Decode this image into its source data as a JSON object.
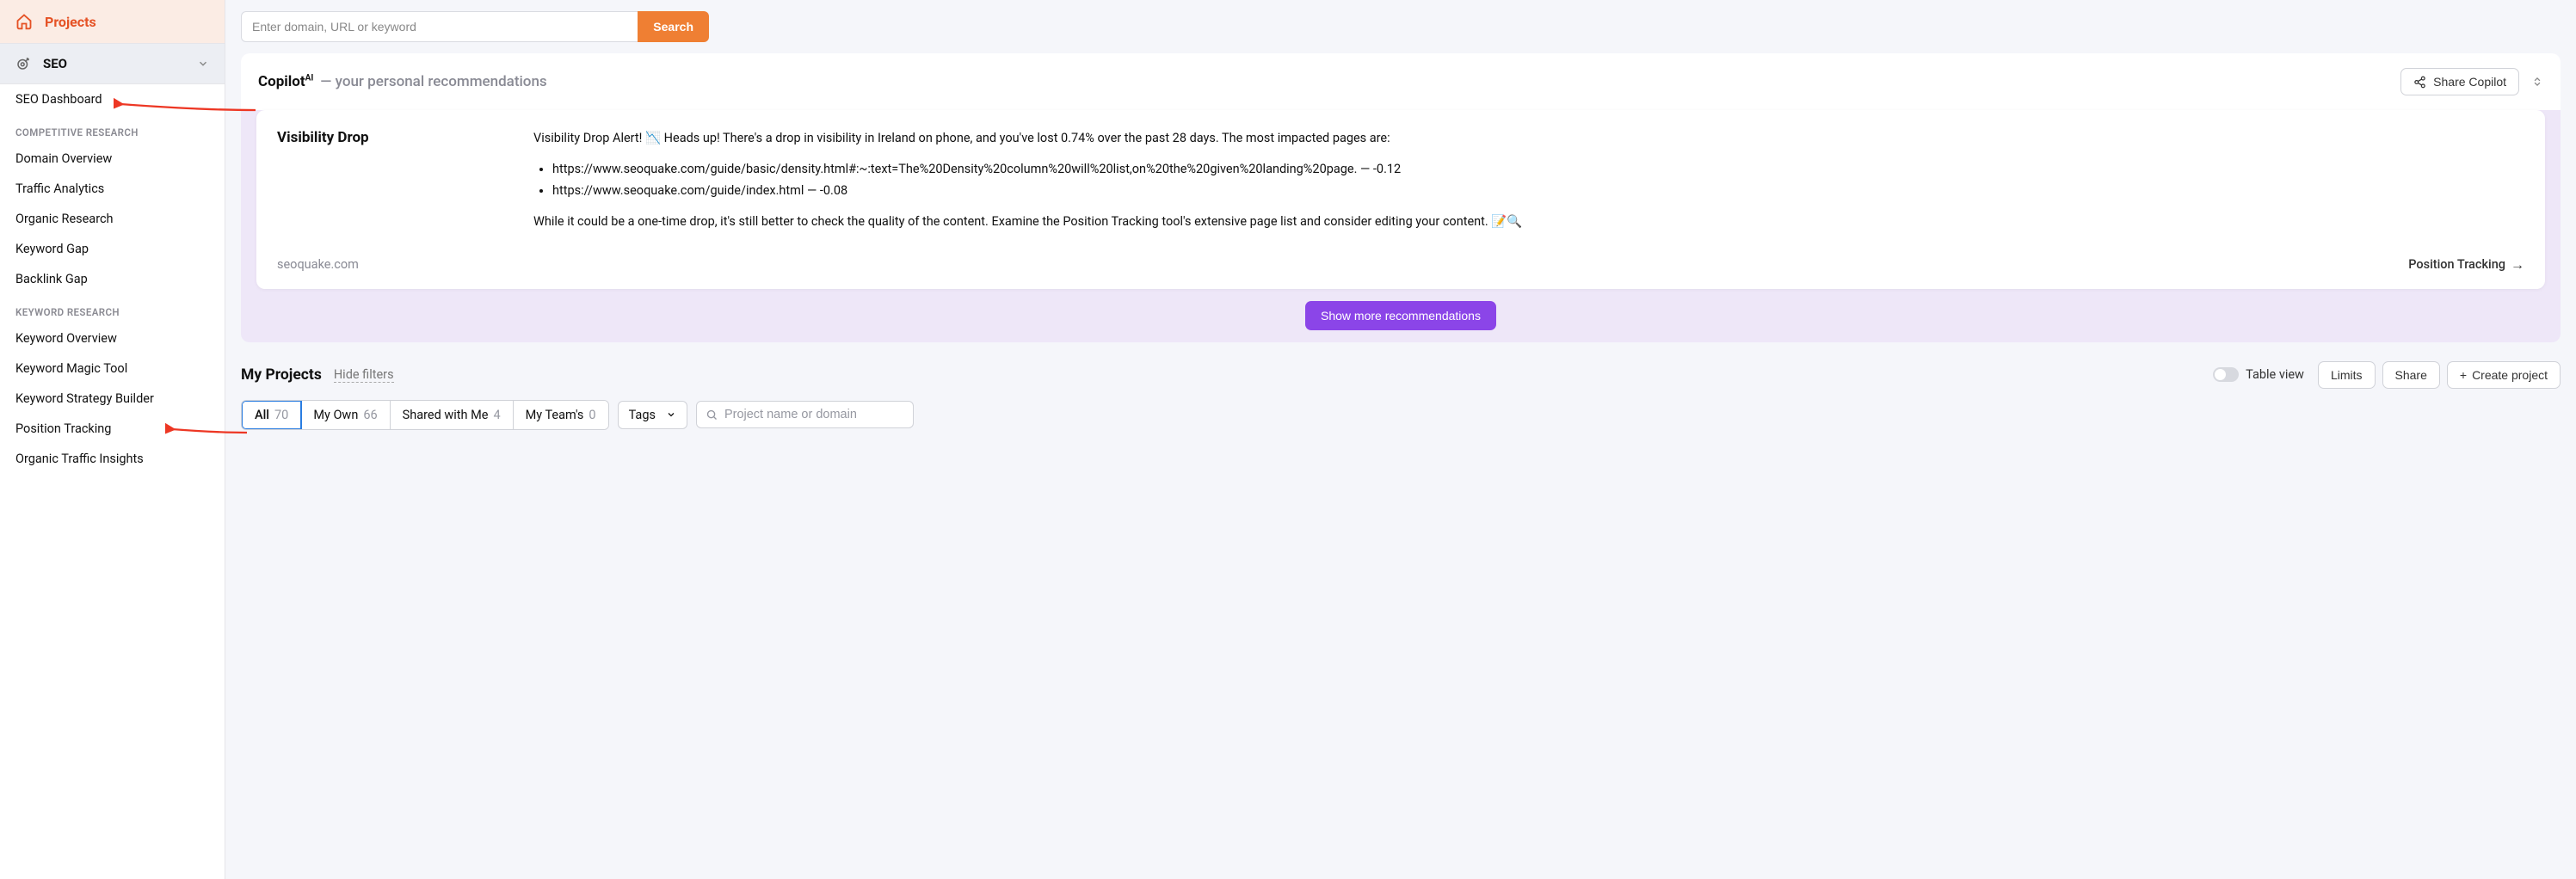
{
  "sidebar": {
    "projects_label": "Projects",
    "seo_label": "SEO",
    "items": [
      "SEO Dashboard"
    ],
    "group1_title": "COMPETITIVE RESEARCH",
    "group1_items": [
      "Domain Overview",
      "Traffic Analytics",
      "Organic Research",
      "Keyword Gap",
      "Backlink Gap"
    ],
    "group2_title": "KEYWORD RESEARCH",
    "group2_items": [
      "Keyword Overview",
      "Keyword Magic Tool",
      "Keyword Strategy Builder",
      "Position Tracking",
      "Organic Traffic Insights"
    ]
  },
  "search": {
    "placeholder": "Enter domain, URL or keyword",
    "button": "Search"
  },
  "copilot": {
    "title": "Copilot",
    "title_sup": "AI",
    "subtitle": "— your personal recommendations",
    "share_label": "Share Copilot",
    "card_title": "Visibility Drop",
    "para1": "Visibility Drop Alert! 📉 Heads up! There's a drop in visibility in Ireland on phone, and you've lost 0.74% over the past 28 days. The most impacted pages are:",
    "bullets": [
      "https://www.seoquake.com/guide/basic/density.html#:~:text=The%20Density%20column%20will%20list,on%20the%20given%20landing%20page. — -0.12",
      "https://www.seoquake.com/guide/index.html — -0.08"
    ],
    "para2": "While it could be a one-time drop, it's still better to check the quality of the content. Examine the Position Tracking tool's extensive page list and consider editing your content. 📝🔍",
    "domain": "seoquake.com",
    "pt_link": "Position Tracking",
    "show_more": "Show more recommendations"
  },
  "projects": {
    "title": "My Projects",
    "hide_filters": "Hide filters",
    "table_view": "Table view",
    "limits": "Limits",
    "share": "Share",
    "create": "Create project",
    "tabs": [
      {
        "label": "All",
        "count": "70"
      },
      {
        "label": "My Own",
        "count": "66"
      },
      {
        "label": "Shared with Me",
        "count": "4"
      },
      {
        "label": "My Team's",
        "count": "0"
      }
    ],
    "tags_label": "Tags",
    "search_placeholder": "Project name or domain"
  }
}
